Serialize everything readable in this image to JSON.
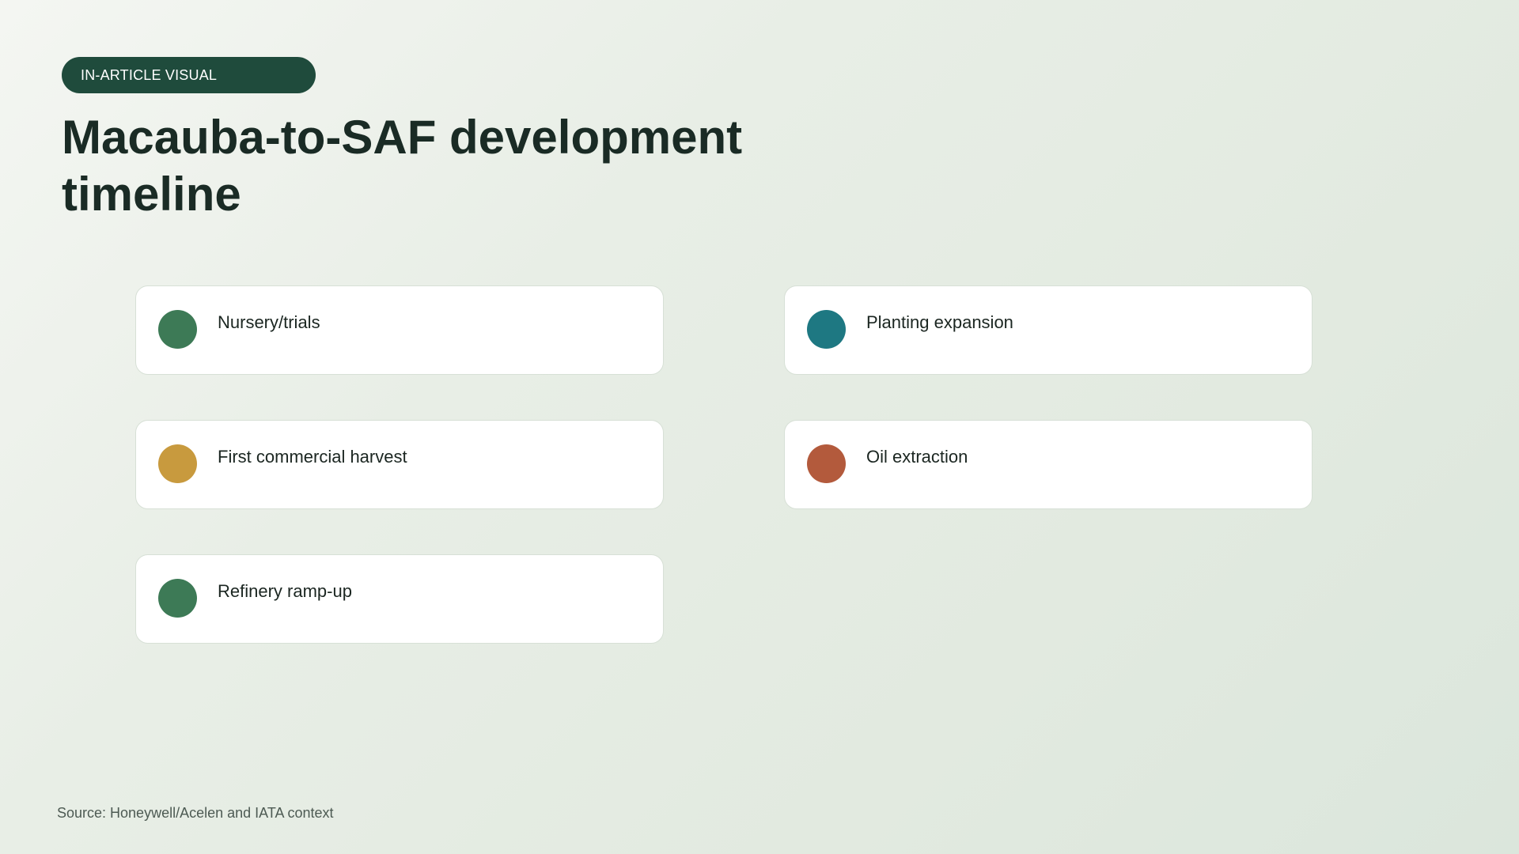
{
  "badge": "IN-ARTICLE VISUAL",
  "title": "Macauba-to-SAF development timeline",
  "colors": {
    "badge_bg": "#1f4b3c",
    "green": "#3d7a56",
    "teal": "#1e7882",
    "gold": "#c89a3e",
    "rust": "#b35a3c"
  },
  "steps": [
    {
      "label": "Nursery/trials",
      "color": "#3d7a56"
    },
    {
      "label": "Planting expansion",
      "color": "#1e7882"
    },
    {
      "label": "First commercial harvest",
      "color": "#c89a3e"
    },
    {
      "label": "Oil extraction",
      "color": "#b35a3c"
    },
    {
      "label": "Refinery ramp-up",
      "color": "#3d7a56"
    }
  ],
  "source": "Source: Honeywell/Acelen and IATA context"
}
